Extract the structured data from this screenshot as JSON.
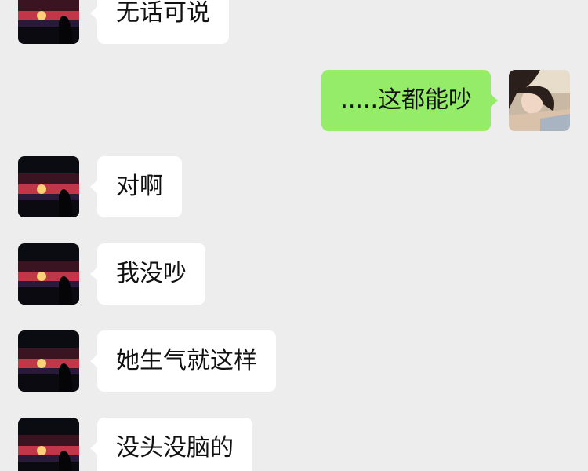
{
  "colors": {
    "background": "#ededed",
    "incoming_bubble": "#ffffff",
    "outgoing_bubble": "#95ec69"
  },
  "contact": {
    "avatar_icon": "sunset-silhouette-avatar"
  },
  "me": {
    "avatar_icon": "girl-photo-avatar"
  },
  "messages": [
    {
      "direction": "in",
      "text": "无话可说"
    },
    {
      "direction": "out",
      "text": ".....这都能吵"
    },
    {
      "direction": "in",
      "text": "对啊"
    },
    {
      "direction": "in",
      "text": "我没吵"
    },
    {
      "direction": "in",
      "text": "她生气就这样"
    },
    {
      "direction": "in",
      "text": "没头没脑的"
    }
  ]
}
